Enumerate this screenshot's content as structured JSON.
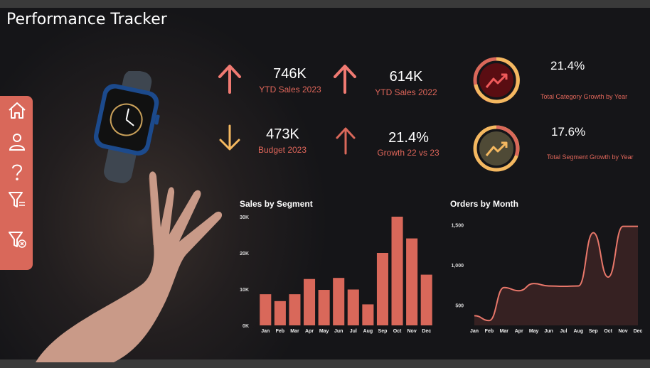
{
  "header": {
    "title": "Performance Tracker"
  },
  "colors": {
    "accent": "#d9685a",
    "up_arrow": "#f07a72",
    "down_arrow": "#f4b860",
    "label": "#e0665a",
    "ring_red_fill": "#5a0d12",
    "ring_olive_fill": "#4f4a36"
  },
  "sidebar": {
    "items": [
      {
        "icon": "home-icon"
      },
      {
        "icon": "user-icon"
      },
      {
        "icon": "help-icon"
      },
      {
        "icon": "filter-icon"
      },
      {
        "icon": "clear-filter-icon"
      }
    ]
  },
  "kpis": [
    {
      "value": "746K",
      "label": "YTD Sales 2023",
      "trend": "up"
    },
    {
      "value": "614K",
      "label": "YTD Sales 2022",
      "trend": "up"
    },
    {
      "value": "473K",
      "label": "Budget 2023",
      "trend": "down"
    },
    {
      "value": "21.4%",
      "label": "Growth 22 vs 23",
      "trend": "up"
    }
  ],
  "growth": [
    {
      "value": "21.4%",
      "label": "Total Category Growth by Year",
      "icon": "trend-up-icon"
    },
    {
      "value": "17.6%",
      "label": "Total Segment Growth by Year",
      "icon": "trend-up-icon"
    }
  ],
  "chart_data": [
    {
      "type": "bar",
      "title": "Sales by Segment",
      "categories": [
        "Jan",
        "Feb",
        "Mar",
        "Apr",
        "May",
        "Jun",
        "Jul",
        "Aug",
        "Sep",
        "Oct",
        "Nov",
        "Dec"
      ],
      "values": [
        8600,
        6700,
        8600,
        12800,
        9800,
        13100,
        9900,
        5800,
        20000,
        30000,
        24000,
        14000
      ],
      "yticks": [
        0,
        10000,
        20000,
        30000
      ],
      "ytick_labels": [
        "0K",
        "10K",
        "20K",
        "30K"
      ],
      "ylim": [
        0,
        30000
      ],
      "color": "#d9685a"
    },
    {
      "type": "area",
      "title": "Orders by Month",
      "categories": [
        "Jan",
        "Feb",
        "Mar",
        "Apr",
        "May",
        "Jun",
        "Jul",
        "Aug",
        "Sep",
        "Oct",
        "Nov",
        "Dec"
      ],
      "values": [
        370,
        310,
        720,
        680,
        770,
        740,
        735,
        740,
        1400,
        850,
        1480,
        1480
      ],
      "yticks": [
        500,
        1000,
        1500
      ],
      "ytick_labels": [
        "500",
        "1,000",
        "1,500"
      ],
      "ylim": [
        250,
        1600
      ],
      "color": "#e8776a"
    }
  ]
}
